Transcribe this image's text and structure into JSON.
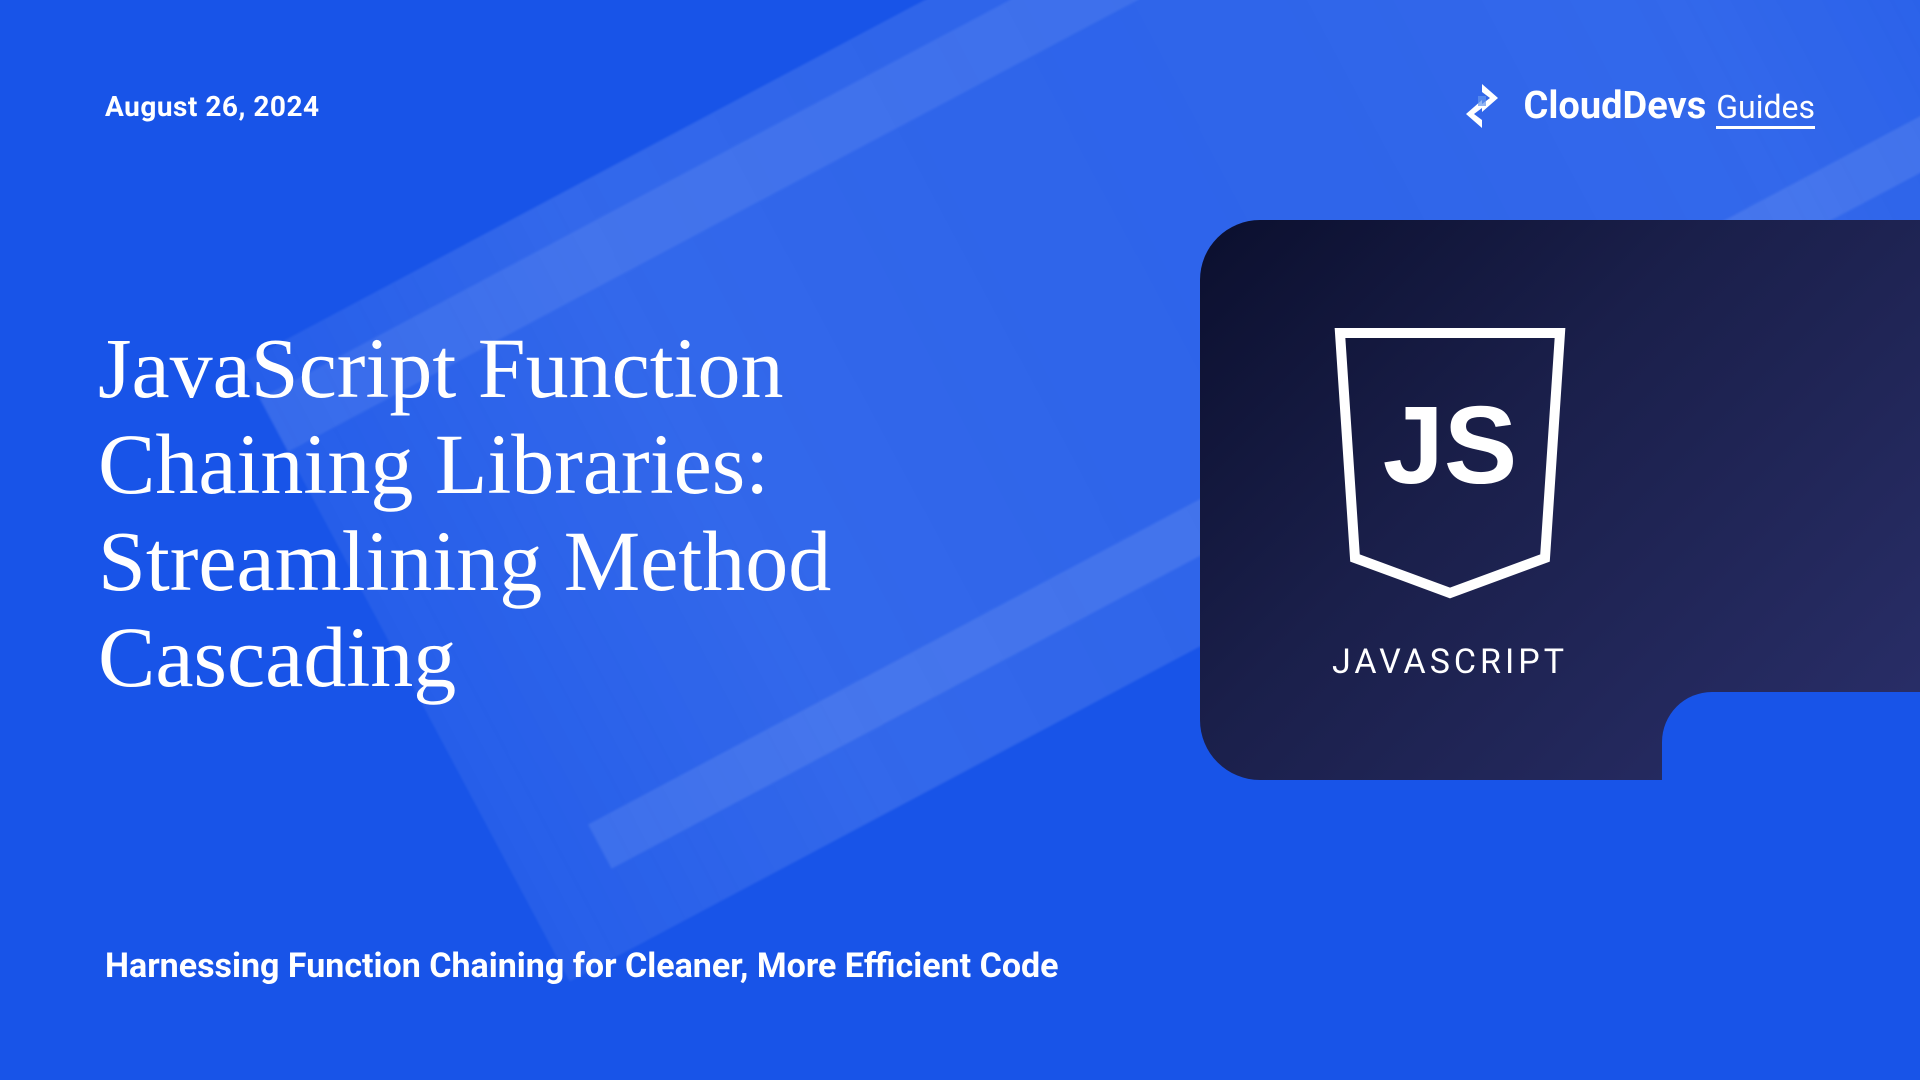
{
  "date": "August 26,  2024",
  "brand": {
    "name": "CloudDevs",
    "suffix": "Guides"
  },
  "title": "JavaScript Function Chaining Libraries: Streamlining Method Cascading",
  "subtitle": "Harnessing Function Chaining for Cleaner, More Efficient Code",
  "card": {
    "logo_text": "JS",
    "label": "JAVASCRIPT"
  },
  "colors": {
    "primary": "#1854E8",
    "card_dark": "#0B0F2E",
    "text": "#FFFFFF"
  }
}
